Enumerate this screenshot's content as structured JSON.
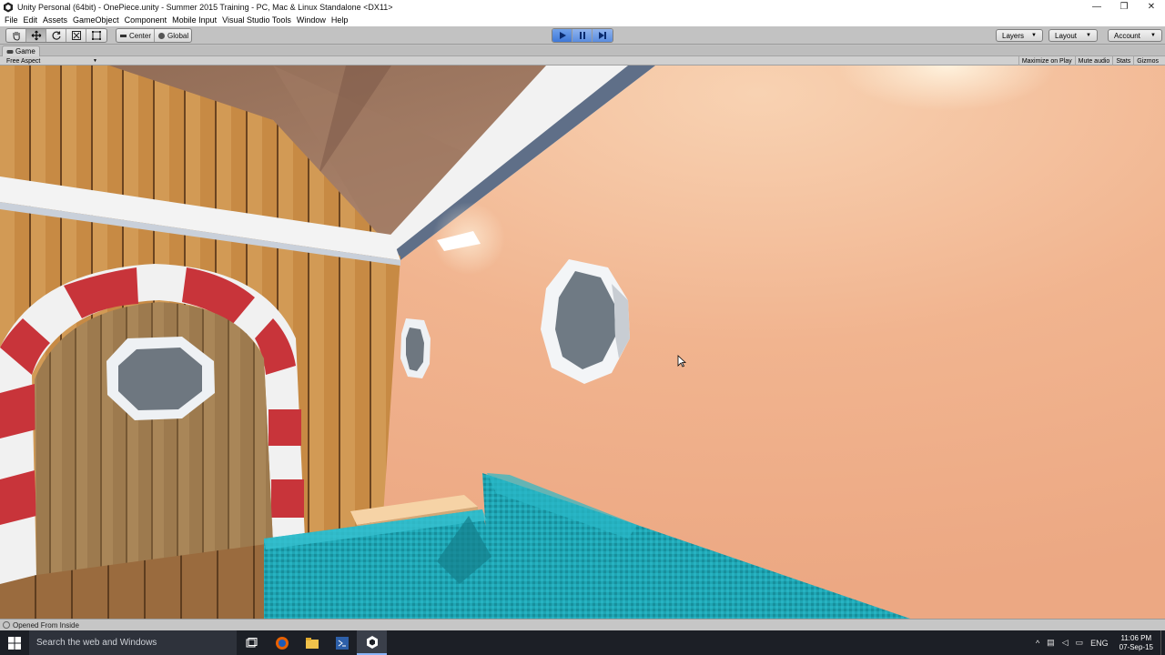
{
  "window": {
    "title": "Unity Personal (64bit) - OnePiece.unity - Summer 2015 Training - PC, Mac & Linux Standalone <DX11>",
    "controls": [
      "—",
      "❐",
      "✕"
    ]
  },
  "menu": [
    "File",
    "Edit",
    "Assets",
    "GameObject",
    "Component",
    "Mobile Input",
    "Visual Studio Tools",
    "Window",
    "Help"
  ],
  "toolbar": {
    "tools": [
      "hand-tool",
      "move-tool",
      "rotate-tool",
      "scale-tool",
      "rect-tool"
    ],
    "pivot_label": "Center",
    "space_label": "Global",
    "play": {
      "playing": true,
      "paused": false
    },
    "layers_label": "Layers",
    "layout_label": "Layout",
    "account_label": "Account"
  },
  "game_view": {
    "tab_label": "Game",
    "aspect_label": "Free Aspect",
    "options": [
      "Maximize on Play",
      "Mute audio",
      "Stats",
      "Gizmos"
    ],
    "colors": {
      "wall": "#f0b28c",
      "sofa": "#23a7b5",
      "door_stripe_red": "#c8343a",
      "wood": "#c68a45"
    }
  },
  "status": {
    "message": "Opened From Inside"
  },
  "taskbar": {
    "search_placeholder": "Search the web and Windows",
    "apps": [
      "task-view",
      "firefox",
      "file-explorer",
      "visual-studio",
      "unity"
    ],
    "language": "ENG",
    "time": "11:06 PM",
    "date": "07-Sep-15"
  }
}
